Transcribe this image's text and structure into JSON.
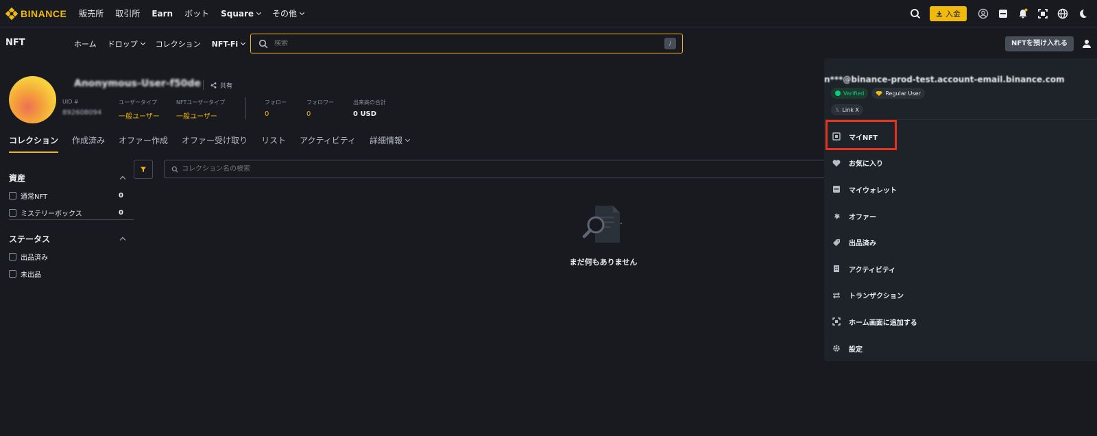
{
  "topbar": {
    "logo_text": "BINANCE",
    "nav": [
      {
        "label": "販売所",
        "caret": false,
        "bold": false
      },
      {
        "label": "取引所",
        "caret": false,
        "bold": false
      },
      {
        "label": "Earn",
        "caret": false,
        "bold": false
      },
      {
        "label": "ボット",
        "caret": false,
        "bold": false
      },
      {
        "label": "Square",
        "caret": true,
        "bold": true
      },
      {
        "label": "その他",
        "caret": true,
        "bold": false
      }
    ],
    "deposit_label": "入金",
    "icons": [
      "search-icon",
      "user-circle-icon",
      "wallet-icon",
      "bell-icon",
      "qr-scan-icon",
      "globe-icon",
      "moon-icon"
    ]
  },
  "nftbar": {
    "title": "NFT",
    "nav": [
      {
        "label": "ホーム",
        "caret": false
      },
      {
        "label": "ドロップ",
        "caret": true
      },
      {
        "label": "コレクション",
        "caret": false
      },
      {
        "label": "NFT-Fi",
        "caret": true
      }
    ],
    "search_placeholder": "検索",
    "search_shortcut": "/",
    "deposit_nft_label": "NFTを預け入れる"
  },
  "profile": {
    "username": "Anonymous-User-f50de",
    "share_label": "共有",
    "stats": [
      {
        "label": "UID #",
        "value": "892608094"
      },
      {
        "label": "ユーザータイプ",
        "value": "一般ユーザー"
      },
      {
        "label": "NFTユーザータイプ",
        "value": "一般ユーザー"
      },
      {
        "label": "フォロー",
        "value": "0"
      },
      {
        "label": "フォロワー",
        "value": "0"
      },
      {
        "label": "出来高の合計",
        "value": "0 USD"
      }
    ]
  },
  "tabs": [
    {
      "label": "コレクション",
      "active": true
    },
    {
      "label": "作成済み",
      "active": false
    },
    {
      "label": "オファー作成",
      "active": false
    },
    {
      "label": "オファー受け取り",
      "active": false
    },
    {
      "label": "リスト",
      "active": false
    },
    {
      "label": "アクティビティ",
      "active": false
    },
    {
      "label": "詳細情報",
      "active": false
    }
  ],
  "filters": {
    "assets": {
      "title": "資産",
      "items": [
        {
          "label": "通常NFT",
          "count": "0"
        },
        {
          "label": "ミステリーボックス",
          "count": "0"
        }
      ]
    },
    "status": {
      "title": "ステータス",
      "items": [
        {
          "label": "出品済み"
        },
        {
          "label": "未出品"
        }
      ]
    }
  },
  "collection_search_placeholder": "コレクション名の検索",
  "empty_text": "まだ何もありません",
  "dropdown": {
    "email": "n***@binance-prod-test.account-email.binance.com",
    "badge_verified": "Verified",
    "badge_user": "Regular User",
    "link_x": "Link X",
    "menu": [
      {
        "label": "マイNFT",
        "icon": "nft-icon"
      },
      {
        "label": "お気に入り",
        "icon": "heart-icon"
      },
      {
        "label": "マイウォレット",
        "icon": "wallet-icon"
      },
      {
        "label": "オファー",
        "icon": "offer-icon"
      },
      {
        "label": "出品済み",
        "icon": "tag-icon"
      },
      {
        "label": "アクティビティ",
        "icon": "activity-icon"
      },
      {
        "label": "トランザクション",
        "icon": "transfer-icon"
      },
      {
        "label": "ホーム画面に追加する",
        "icon": "add-home-icon"
      },
      {
        "label": "設定",
        "icon": "gear-icon"
      }
    ]
  },
  "colors": {
    "accent": "#f0b90b",
    "background": "#181a20",
    "panel": "#1e2329",
    "highlight": "#e8321b",
    "verified": "#0ecb81"
  }
}
